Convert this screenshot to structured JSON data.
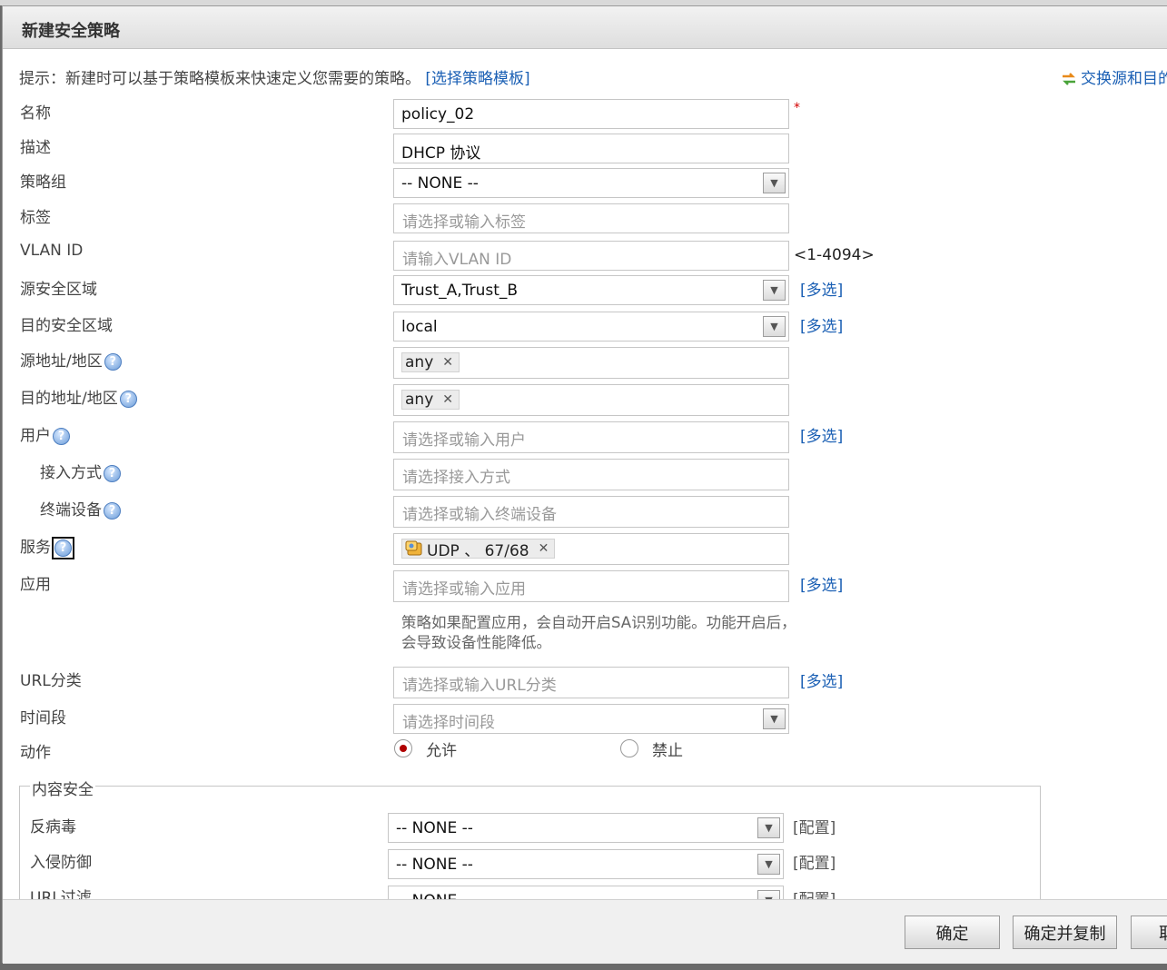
{
  "dialog": {
    "title": "新建安全策略"
  },
  "hint": {
    "text": "提示：新建时可以基于策略模板来快速定义您需要的策略。",
    "link": "[选择策略模板]"
  },
  "swap_link": "交换源和目的",
  "fields": {
    "name": {
      "label": "名称",
      "value": "policy_02",
      "required_mark": "*"
    },
    "description": {
      "label": "描述",
      "value": "DHCP 协议"
    },
    "policy_group": {
      "label": "策略组",
      "value": "-- NONE --"
    },
    "tag": {
      "label": "标签",
      "placeholder": "请选择或输入标签"
    },
    "vlan": {
      "label": "VLAN ID",
      "placeholder": "请输入VLAN ID",
      "range": "<1-4094>"
    },
    "src_zone": {
      "label": "源安全区域",
      "value": "Trust_A,Trust_B",
      "multi": "[多选]"
    },
    "dst_zone": {
      "label": "目的安全区域",
      "value": "local",
      "multi": "[多选]"
    },
    "src_addr": {
      "label": "源地址/地区",
      "tag": "any"
    },
    "dst_addr": {
      "label": "目的地址/地区",
      "tag": "any"
    },
    "user": {
      "label": "用户",
      "placeholder": "请选择或输入用户",
      "multi": "[多选]"
    },
    "access": {
      "label": "接入方式",
      "placeholder": "请选择接入方式"
    },
    "device": {
      "label": "终端设备",
      "placeholder": "请选择或输入终端设备"
    },
    "service": {
      "label": "服务",
      "tag": "UDP 、 67/68"
    },
    "application": {
      "label": "应用",
      "placeholder": "请选择或输入应用",
      "multi": "[多选]",
      "note": "策略如果配置应用，会自动开启SA识别功能。功能开启后，会导致设备性能降低。"
    },
    "url_category": {
      "label": "URL分类",
      "placeholder": "请选择或输入URL分类",
      "multi": "[多选]"
    },
    "time_range": {
      "label": "时间段",
      "placeholder": "请选择时间段"
    },
    "action": {
      "label": "动作",
      "permit": "允许",
      "deny": "禁止",
      "selected": "允许"
    }
  },
  "content_security": {
    "legend": "内容安全",
    "antivirus": {
      "label": "反病毒",
      "value": "-- NONE --",
      "config": "[配置]"
    },
    "ips": {
      "label": "入侵防御",
      "value": "-- NONE --",
      "config": "[配置]"
    },
    "url_filter": {
      "label": "URL过滤",
      "value": "-- NONE --",
      "config": "[配置]"
    }
  },
  "footer": {
    "ok": "确定",
    "ok_copy": "确定并复制",
    "cancel": "取消"
  },
  "icons": {
    "help": "help-icon",
    "dropdown": "chevron-down-icon",
    "remove": "close-icon",
    "swap": "swap-icon",
    "service": "service-icon"
  },
  "colors": {
    "link": "#1a5fb4",
    "required": "#d40000",
    "radio_selected": "#b00000"
  }
}
